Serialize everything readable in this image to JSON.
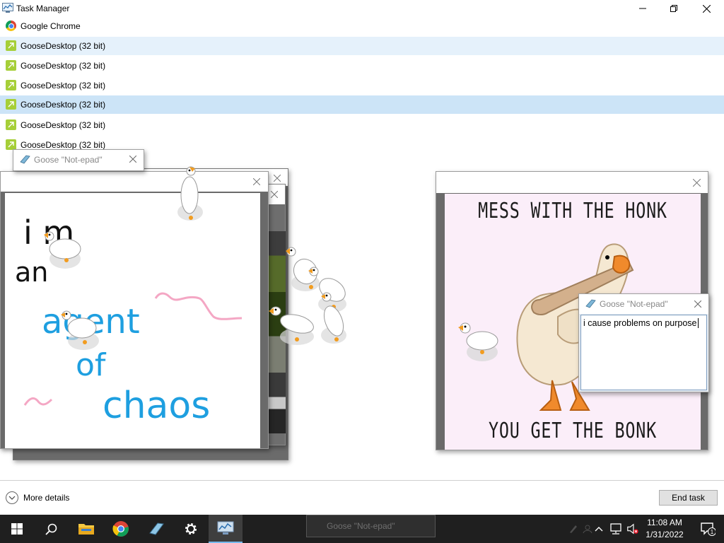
{
  "task_manager": {
    "title": "Task Manager",
    "processes": [
      {
        "name": "Google Chrome",
        "icon": "chrome-icon",
        "state": "normal"
      },
      {
        "name": "GooseDesktop (32 bit)",
        "icon": "goose-desktop-icon",
        "state": "selected-light"
      },
      {
        "name": "GooseDesktop (32 bit)",
        "icon": "goose-desktop-icon",
        "state": "normal"
      },
      {
        "name": "GooseDesktop (32 bit)",
        "icon": "goose-desktop-icon",
        "state": "normal"
      },
      {
        "name": "GooseDesktop (32 bit)",
        "icon": "goose-desktop-icon",
        "state": "selected"
      },
      {
        "name": "GooseDesktop (32 bit)",
        "icon": "goose-desktop-icon",
        "state": "normal"
      },
      {
        "name": "GooseDesktop (32 bit)",
        "icon": "goose-desktop-icon",
        "state": "normal"
      }
    ],
    "more_details_label": "More details",
    "end_task_label": "End task"
  },
  "goose_notepads": [
    {
      "title": "Goose \"Not-epad\"",
      "text": ""
    },
    {
      "title": "Goose \"Not-epad\"",
      "text": "i cause problems on purpose"
    }
  ],
  "drawing_note": {
    "line1": "i  m",
    "line2": "an",
    "line3": "agent",
    "line4": "of",
    "line5": "chaos"
  },
  "poster": {
    "top_text": "MESS WITH THE HONK",
    "bottom_text": "YOU GET THE BONK"
  },
  "taskbar": {
    "ghost_window_title": "Goose \"Not-epad\"",
    "clock_time": "11:08 AM",
    "clock_date": "1/31/2022",
    "notification_count": "1"
  },
  "colors": {
    "selection_strong": "#cce4f7",
    "selection_light": "#e5f1fb",
    "taskbar_bg": "#1f1f1f",
    "marker_blue": "#1e9fe0",
    "marker_pink": "#f4a7c4",
    "poster_bg": "#fbeef9"
  }
}
